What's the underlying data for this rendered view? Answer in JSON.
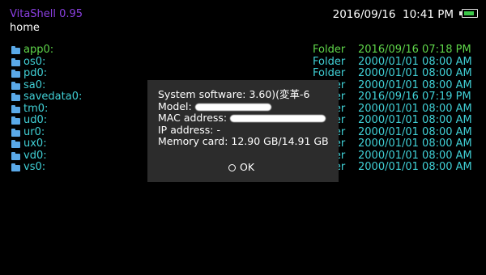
{
  "header": {
    "app_title": "VitaShell 0.95",
    "path": "home",
    "datetime": "2016/09/16  10:41 PM",
    "battery_icon": "battery-icon",
    "battery_level": 0.85
  },
  "files": [
    {
      "name": "app0:",
      "type": "Folder",
      "date": "2016/09/16 07:18 PM",
      "selected": true
    },
    {
      "name": "os0:",
      "type": "Folder",
      "date": "2000/01/01 08:00 AM"
    },
    {
      "name": "pd0:",
      "type": "Folder",
      "date": "2000/01/01 08:00 AM"
    },
    {
      "name": "sa0:",
      "type": "Folder",
      "date": "2000/01/01 08:00 AM"
    },
    {
      "name": "savedata0:",
      "type": "Folder",
      "date": "2016/09/16 07:19 PM"
    },
    {
      "name": "tm0:",
      "type": "Folder",
      "date": "2000/01/01 08:00 AM"
    },
    {
      "name": "ud0:",
      "type": "Folder",
      "date": "2000/01/01 08:00 AM"
    },
    {
      "name": "ur0:",
      "type": "Folder",
      "date": "2000/01/01 08:00 AM"
    },
    {
      "name": "ux0:",
      "type": "Folder",
      "date": "2000/01/01 08:00 AM"
    },
    {
      "name": "vd0:",
      "type": "Folder",
      "date": "2000/01/01 08:00 AM"
    },
    {
      "name": "vs0:",
      "type": "Folder",
      "date": "2000/01/01 08:00 AM"
    }
  ],
  "dialog": {
    "system_software": "System software: 3.60)(変革-6",
    "model_label": "Model:",
    "mac_label": "MAC address:",
    "ip_address": "IP address: -",
    "memory_card": "Memory card: 12.90 GB/14.91 GB",
    "ok_label": "OK",
    "ok_icon": "circle-icon"
  },
  "colors": {
    "title": "#8a3fe0",
    "item": "#40d0d6",
    "selected": "#5fd64a",
    "dialog_bg": "#2c2c2c",
    "folder_icon": "#5aa9e8"
  }
}
